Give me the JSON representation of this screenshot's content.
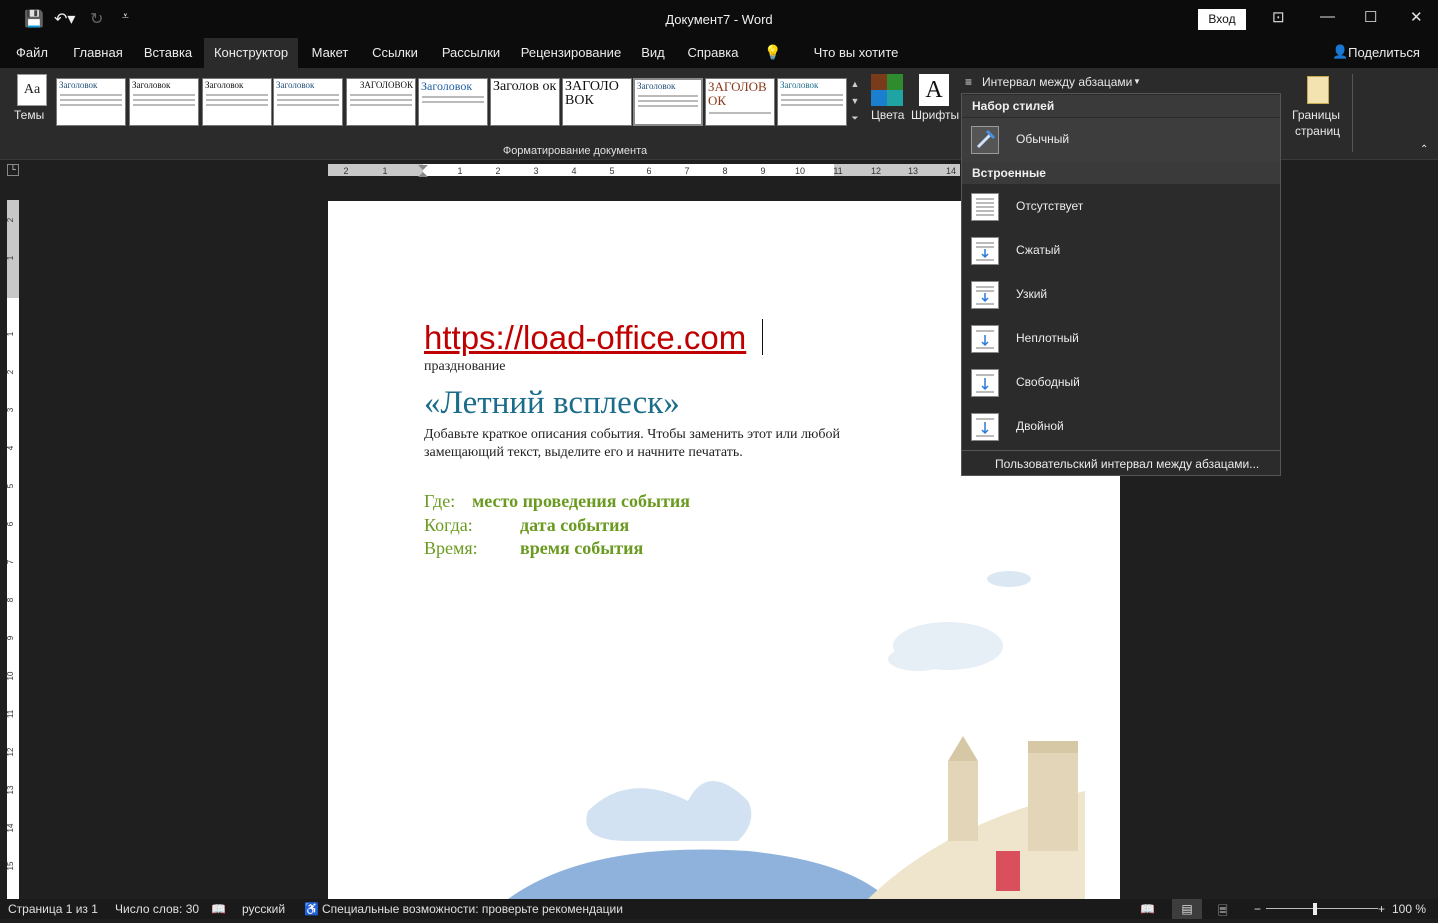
{
  "window": {
    "title": "Документ7  -  Word",
    "signin_label": "Вход"
  },
  "tabs": [
    "Файл",
    "Главная",
    "Вставка",
    "Конструктор",
    "Макет",
    "Ссылки",
    "Рассылки",
    "Рецензирование",
    "Вид",
    "Справка"
  ],
  "active_tab": "Конструктор",
  "tell_me": "Что вы хотите сделать?",
  "share_label": "Поделиться",
  "ribbon": {
    "themes_label": "Темы",
    "colors_label": "Цвета",
    "fonts_label": "Шрифты",
    "paragraph_spacing_label": "Интервал между абзацами",
    "page_borders_label_1": "Границы",
    "page_borders_label_2": "страниц",
    "group_label": "Форматирование документа",
    "style_thumbs": [
      "Заголовок",
      "Заголовок",
      "Заголовок",
      "Заголовок",
      "ЗАГОЛОВОК",
      "Заголовок",
      "Заголов ок",
      "ЗАГОЛО ВОК",
      "Заголовок",
      "ЗАГОЛОВ ОК",
      "Заголовок"
    ]
  },
  "ruler_h_ticks": [
    "2",
    "1",
    "1",
    "1",
    "2",
    "3",
    "4",
    "5",
    "6",
    "7",
    "8",
    "9",
    "10",
    "11",
    "12",
    "13",
    "14"
  ],
  "ruler_v_ticks": [
    "2",
    "1",
    "1",
    "2",
    "3",
    "4",
    "5",
    "6",
    "7",
    "8",
    "9",
    "10",
    "11",
    "12",
    "13",
    "14",
    "15"
  ],
  "document": {
    "url": "https://load-office.com",
    "subtitle": "празднование",
    "title": "«Летний всплеск»",
    "description": "Добавьте краткое описания события. Чтобы заменить этот или любой замещающий текст, выделите его и начните печатать.",
    "where_label": "Где:",
    "where_value": "место проведения события",
    "when_label": "Когда:",
    "when_value": "дата события",
    "time_label": "Время:",
    "time_value": "время события"
  },
  "dropdown": {
    "style_set_header": "Набор стилей",
    "normal_label": "Обычный",
    "builtin_header": "Встроенные",
    "items": [
      "Отсутствует",
      "Сжатый",
      "Узкий",
      "Неплотный",
      "Свободный",
      "Двойной"
    ],
    "custom_label": "Пользовательский интервал между абзацами..."
  },
  "statusbar": {
    "page": "Страница 1 из 1",
    "words": "Число слов: 30",
    "language": "русский",
    "accessibility": "Специальные возможности: проверьте рекомендации",
    "zoom": "100 %"
  }
}
